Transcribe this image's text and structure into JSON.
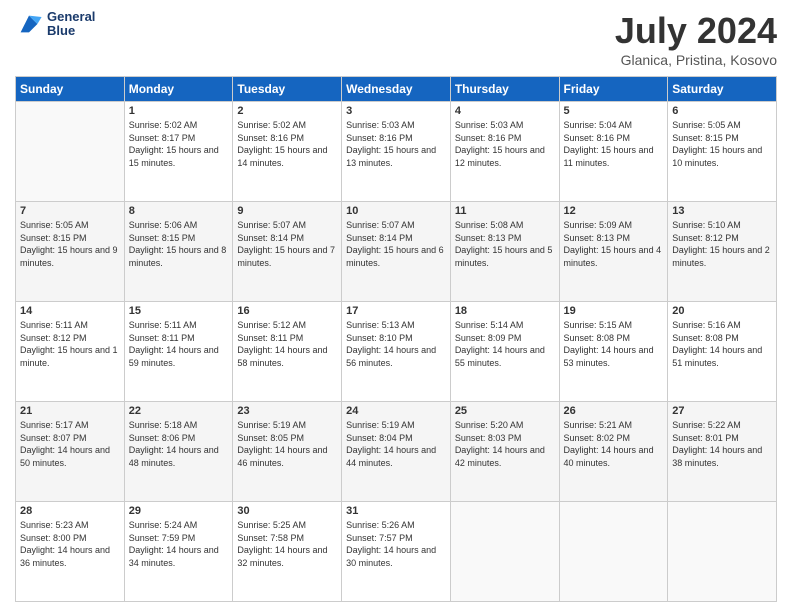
{
  "header": {
    "logo": {
      "line1": "General",
      "line2": "Blue"
    },
    "title": "July 2024",
    "subtitle": "Glanica, Pristina, Kosovo"
  },
  "calendar": {
    "days_header": [
      "Sunday",
      "Monday",
      "Tuesday",
      "Wednesday",
      "Thursday",
      "Friday",
      "Saturday"
    ],
    "weeks": [
      [
        {
          "day": "",
          "sunrise": "",
          "sunset": "",
          "daylight": ""
        },
        {
          "day": "1",
          "sunrise": "Sunrise: 5:02 AM",
          "sunset": "Sunset: 8:17 PM",
          "daylight": "Daylight: 15 hours and 15 minutes."
        },
        {
          "day": "2",
          "sunrise": "Sunrise: 5:02 AM",
          "sunset": "Sunset: 8:16 PM",
          "daylight": "Daylight: 15 hours and 14 minutes."
        },
        {
          "day": "3",
          "sunrise": "Sunrise: 5:03 AM",
          "sunset": "Sunset: 8:16 PM",
          "daylight": "Daylight: 15 hours and 13 minutes."
        },
        {
          "day": "4",
          "sunrise": "Sunrise: 5:03 AM",
          "sunset": "Sunset: 8:16 PM",
          "daylight": "Daylight: 15 hours and 12 minutes."
        },
        {
          "day": "5",
          "sunrise": "Sunrise: 5:04 AM",
          "sunset": "Sunset: 8:16 PM",
          "daylight": "Daylight: 15 hours and 11 minutes."
        },
        {
          "day": "6",
          "sunrise": "Sunrise: 5:05 AM",
          "sunset": "Sunset: 8:15 PM",
          "daylight": "Daylight: 15 hours and 10 minutes."
        }
      ],
      [
        {
          "day": "7",
          "sunrise": "Sunrise: 5:05 AM",
          "sunset": "Sunset: 8:15 PM",
          "daylight": "Daylight: 15 hours and 9 minutes."
        },
        {
          "day": "8",
          "sunrise": "Sunrise: 5:06 AM",
          "sunset": "Sunset: 8:15 PM",
          "daylight": "Daylight: 15 hours and 8 minutes."
        },
        {
          "day": "9",
          "sunrise": "Sunrise: 5:07 AM",
          "sunset": "Sunset: 8:14 PM",
          "daylight": "Daylight: 15 hours and 7 minutes."
        },
        {
          "day": "10",
          "sunrise": "Sunrise: 5:07 AM",
          "sunset": "Sunset: 8:14 PM",
          "daylight": "Daylight: 15 hours and 6 minutes."
        },
        {
          "day": "11",
          "sunrise": "Sunrise: 5:08 AM",
          "sunset": "Sunset: 8:13 PM",
          "daylight": "Daylight: 15 hours and 5 minutes."
        },
        {
          "day": "12",
          "sunrise": "Sunrise: 5:09 AM",
          "sunset": "Sunset: 8:13 PM",
          "daylight": "Daylight: 15 hours and 4 minutes."
        },
        {
          "day": "13",
          "sunrise": "Sunrise: 5:10 AM",
          "sunset": "Sunset: 8:12 PM",
          "daylight": "Daylight: 15 hours and 2 minutes."
        }
      ],
      [
        {
          "day": "14",
          "sunrise": "Sunrise: 5:11 AM",
          "sunset": "Sunset: 8:12 PM",
          "daylight": "Daylight: 15 hours and 1 minute."
        },
        {
          "day": "15",
          "sunrise": "Sunrise: 5:11 AM",
          "sunset": "Sunset: 8:11 PM",
          "daylight": "Daylight: 14 hours and 59 minutes."
        },
        {
          "day": "16",
          "sunrise": "Sunrise: 5:12 AM",
          "sunset": "Sunset: 8:11 PM",
          "daylight": "Daylight: 14 hours and 58 minutes."
        },
        {
          "day": "17",
          "sunrise": "Sunrise: 5:13 AM",
          "sunset": "Sunset: 8:10 PM",
          "daylight": "Daylight: 14 hours and 56 minutes."
        },
        {
          "day": "18",
          "sunrise": "Sunrise: 5:14 AM",
          "sunset": "Sunset: 8:09 PM",
          "daylight": "Daylight: 14 hours and 55 minutes."
        },
        {
          "day": "19",
          "sunrise": "Sunrise: 5:15 AM",
          "sunset": "Sunset: 8:08 PM",
          "daylight": "Daylight: 14 hours and 53 minutes."
        },
        {
          "day": "20",
          "sunrise": "Sunrise: 5:16 AM",
          "sunset": "Sunset: 8:08 PM",
          "daylight": "Daylight: 14 hours and 51 minutes."
        }
      ],
      [
        {
          "day": "21",
          "sunrise": "Sunrise: 5:17 AM",
          "sunset": "Sunset: 8:07 PM",
          "daylight": "Daylight: 14 hours and 50 minutes."
        },
        {
          "day": "22",
          "sunrise": "Sunrise: 5:18 AM",
          "sunset": "Sunset: 8:06 PM",
          "daylight": "Daylight: 14 hours and 48 minutes."
        },
        {
          "day": "23",
          "sunrise": "Sunrise: 5:19 AM",
          "sunset": "Sunset: 8:05 PM",
          "daylight": "Daylight: 14 hours and 46 minutes."
        },
        {
          "day": "24",
          "sunrise": "Sunrise: 5:19 AM",
          "sunset": "Sunset: 8:04 PM",
          "daylight": "Daylight: 14 hours and 44 minutes."
        },
        {
          "day": "25",
          "sunrise": "Sunrise: 5:20 AM",
          "sunset": "Sunset: 8:03 PM",
          "daylight": "Daylight: 14 hours and 42 minutes."
        },
        {
          "day": "26",
          "sunrise": "Sunrise: 5:21 AM",
          "sunset": "Sunset: 8:02 PM",
          "daylight": "Daylight: 14 hours and 40 minutes."
        },
        {
          "day": "27",
          "sunrise": "Sunrise: 5:22 AM",
          "sunset": "Sunset: 8:01 PM",
          "daylight": "Daylight: 14 hours and 38 minutes."
        }
      ],
      [
        {
          "day": "28",
          "sunrise": "Sunrise: 5:23 AM",
          "sunset": "Sunset: 8:00 PM",
          "daylight": "Daylight: 14 hours and 36 minutes."
        },
        {
          "day": "29",
          "sunrise": "Sunrise: 5:24 AM",
          "sunset": "Sunset: 7:59 PM",
          "daylight": "Daylight: 14 hours and 34 minutes."
        },
        {
          "day": "30",
          "sunrise": "Sunrise: 5:25 AM",
          "sunset": "Sunset: 7:58 PM",
          "daylight": "Daylight: 14 hours and 32 minutes."
        },
        {
          "day": "31",
          "sunrise": "Sunrise: 5:26 AM",
          "sunset": "Sunset: 7:57 PM",
          "daylight": "Daylight: 14 hours and 30 minutes."
        },
        {
          "day": "",
          "sunrise": "",
          "sunset": "",
          "daylight": ""
        },
        {
          "day": "",
          "sunrise": "",
          "sunset": "",
          "daylight": ""
        },
        {
          "day": "",
          "sunrise": "",
          "sunset": "",
          "daylight": ""
        }
      ]
    ]
  }
}
